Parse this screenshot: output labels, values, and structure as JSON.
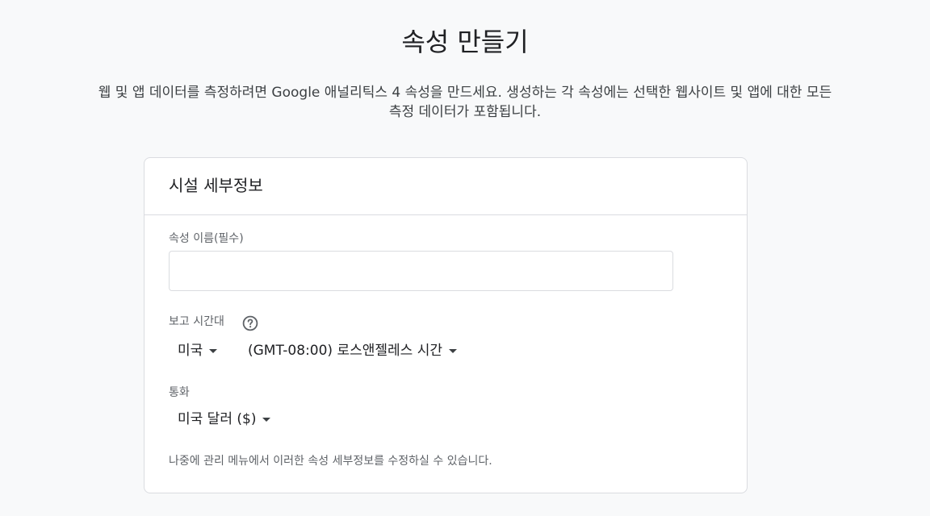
{
  "page": {
    "title": "속성 만들기",
    "intro_line1": "웹 및 앱 데이터를 측정하려면 Google 애널리틱스 4 속성을 만드세요. 생성하는 각 속성에는 선택한 웹사이트 및 앱에 대한 모든",
    "intro_line2": "측정 데이터가 포함됩니다."
  },
  "card": {
    "title": "시설 세부정보",
    "property_name": {
      "label": "속성 이름(필수)",
      "value": "",
      "placeholder": ""
    },
    "timezone": {
      "label": "보고 시간대",
      "help_icon": "help-circle-icon",
      "country": "미국",
      "zone": "(GMT-08:00) 로스앤젤레스 시간"
    },
    "currency": {
      "label": "통화",
      "value": "미국 달러 ($)"
    },
    "footnote": "나중에 관리 메뉴에서 이러한 속성 세부정보를 수정하실 수 있습니다."
  },
  "colors": {
    "background": "#f8f9fa",
    "card_border": "#dadce0",
    "text_primary": "#202124",
    "text_secondary": "#5f6368"
  }
}
